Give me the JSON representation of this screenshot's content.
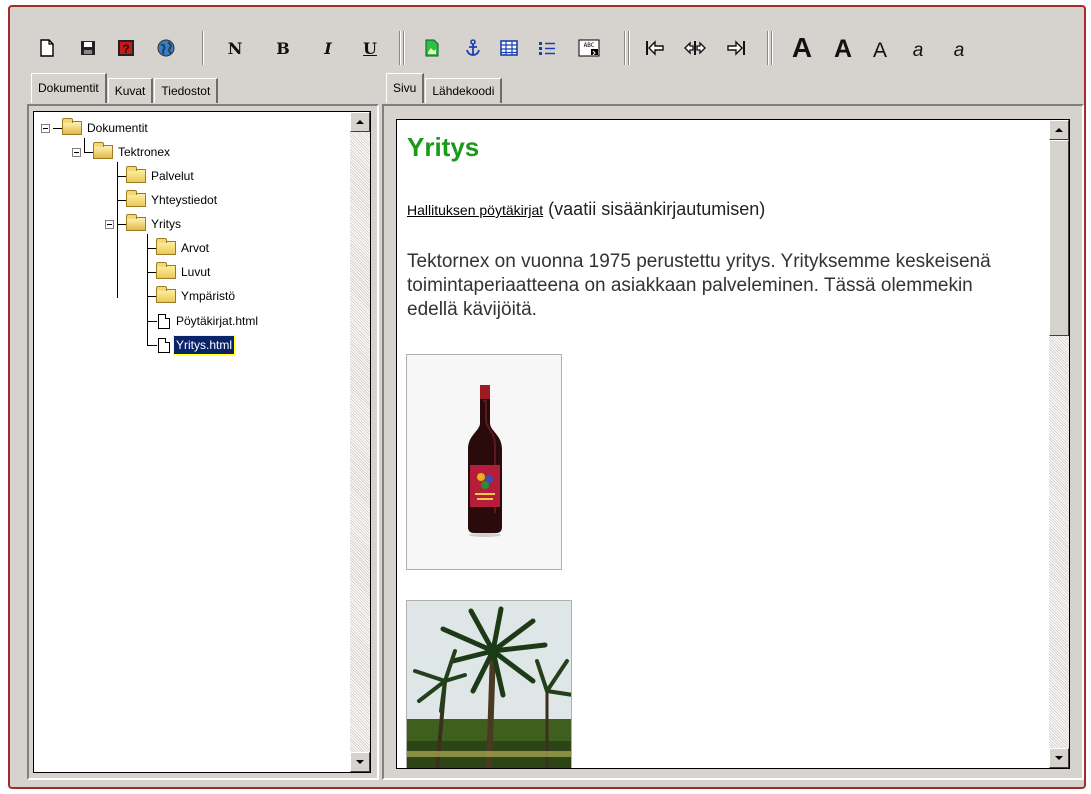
{
  "toolbar": {
    "file_buttons": [
      {
        "name": "new-document-icon"
      },
      {
        "name": "save-icon"
      },
      {
        "name": "help-icon"
      },
      {
        "name": "web-preview-icon"
      }
    ],
    "format_labels": {
      "normal": "N",
      "bold": "B",
      "italic": "I",
      "underline": "U"
    },
    "insert_buttons": [
      {
        "name": "insert-image-icon"
      },
      {
        "name": "insert-anchor-icon"
      },
      {
        "name": "insert-table-icon"
      },
      {
        "name": "insert-list-icon"
      },
      {
        "name": "insert-form-field-icon"
      }
    ],
    "align_buttons": [
      {
        "name": "align-left-icon"
      },
      {
        "name": "align-center-icon"
      },
      {
        "name": "align-right-icon"
      }
    ],
    "font_size_labels": [
      "A",
      "A",
      "A",
      "a",
      "a"
    ]
  },
  "left_tabs": [
    "Dokumentit",
    "Kuvat",
    "Tiedostot"
  ],
  "tree": {
    "items": [
      {
        "label": "Dokumentit",
        "type": "folder-open"
      },
      {
        "label": "Tektronex",
        "type": "folder-open"
      },
      {
        "label": "Palvelut",
        "type": "folder"
      },
      {
        "label": "Yhteystiedot",
        "type": "folder"
      },
      {
        "label": "Yritys",
        "type": "folder-open"
      },
      {
        "label": "Arvot",
        "type": "folder"
      },
      {
        "label": "Luvut",
        "type": "folder"
      },
      {
        "label": "Ympäristö",
        "type": "folder"
      },
      {
        "label": "Pöytäkirjat.html",
        "type": "file"
      },
      {
        "label": "Yritys.html",
        "type": "file",
        "selected": true
      }
    ]
  },
  "right_tabs": [
    "Sivu",
    "Lähdekoodi"
  ],
  "page": {
    "title": "Yritys",
    "link_text": "Hallituksen pöytäkirjat",
    "link_suffix": " (vaatii sisäänkirjautumisen)",
    "intro": "Tektornex on vuonna 1975 perustettu yritys. Yrityksemme keskeisenä toimintaperiaatteena on asiakkaan palveleminen. Tässä olemmekin edellä kävijöitä."
  },
  "colors": {
    "title_green": "#1a9a1a",
    "selection_blue": "#0a246a",
    "window_border": "#a52a2a"
  }
}
